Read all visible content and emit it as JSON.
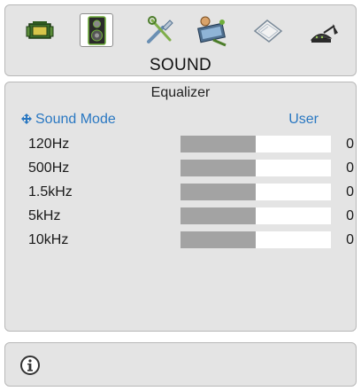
{
  "menu": {
    "title": "SOUND",
    "tabs": [
      {
        "icon": "picture-icon"
      },
      {
        "icon": "speaker-icon",
        "selected": true
      },
      {
        "icon": "tools-icon"
      },
      {
        "icon": "channel-setup-icon"
      },
      {
        "icon": "book-icon"
      },
      {
        "icon": "satellite-dish-icon"
      }
    ]
  },
  "equalizer": {
    "section_title": "Equalizer",
    "sound_mode_label": "Sound Mode",
    "sound_mode_value": "User",
    "bands": [
      {
        "label": "120Hz",
        "value": "0",
        "level": 0.5
      },
      {
        "label": "500Hz",
        "value": "0",
        "level": 0.5
      },
      {
        "label": "1.5kHz",
        "value": "0",
        "level": 0.5
      },
      {
        "label": "5kHz",
        "value": "0",
        "level": 0.5
      },
      {
        "label": "10kHz",
        "value": "0",
        "level": 0.5
      }
    ]
  },
  "info": {
    "icon": "info-icon"
  },
  "colors": {
    "panel": "#e4e4e4",
    "accent": "#2a78c2",
    "slider_fill": "#a3a3a3",
    "slider_track": "#ffffff"
  }
}
